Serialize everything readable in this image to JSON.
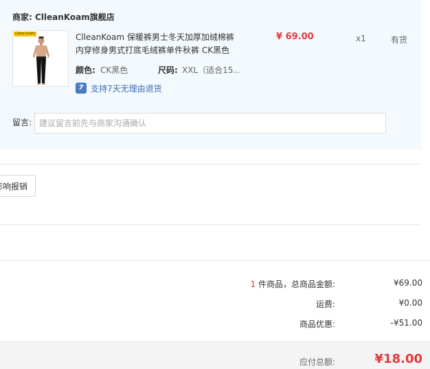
{
  "store": {
    "label": "商家:",
    "name": "ClleanKoam旗舰店"
  },
  "product": {
    "thumb_brand": "Cllean Koam",
    "title": "ClleanKoam 保暖裤男士冬天加厚加绒棉裤内穿修身男式打底毛绒裤单件秋裤 CK黑色",
    "price": "¥ 69.00",
    "quantity": "x1",
    "stock": "有货",
    "color_label": "颜色:",
    "color_value": "CK黑色",
    "size_label": "尺码:",
    "size_value": "XXL（适合15...",
    "return_icon": "7",
    "return_policy": "支持7天无理由退货"
  },
  "remark": {
    "label": "留言:",
    "placeholder": "建议留言前先与商家沟通确认",
    "value": ""
  },
  "invoice_button": "影响报销",
  "summary": {
    "count_number": "1",
    "count_text": " 件商品，总商品金额:",
    "subtotal": "¥69.00",
    "shipping_label": "运费:",
    "shipping": "¥0.00",
    "discount_label": "商品优惠:",
    "discount": "-¥51.00",
    "payable_label": "应付总额:",
    "payable": "¥18.00"
  },
  "colors": {
    "panel_bg": "#f3f9fd",
    "price_red": "#e4393c",
    "link_blue": "#3b6db5"
  }
}
